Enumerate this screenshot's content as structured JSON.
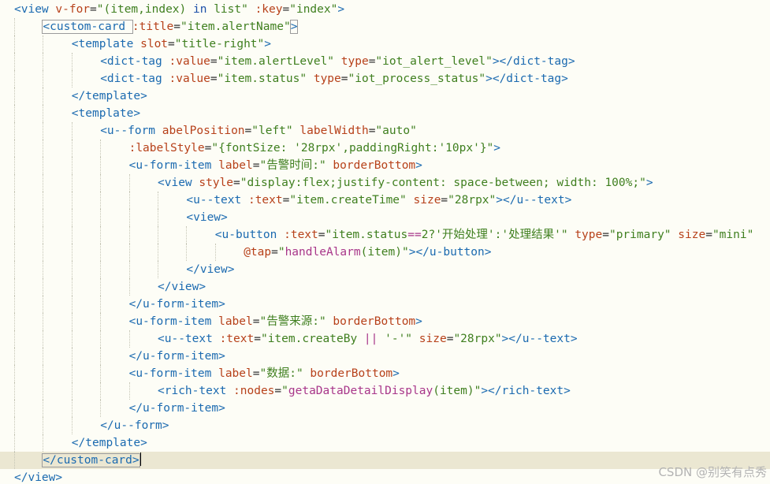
{
  "editor": {
    "watermark": "CSDN @别笑有点秀",
    "lines": [
      {
        "indent": 0,
        "tokens": [
          {
            "t": "<view ",
            "c": "tag"
          },
          {
            "t": "v-for",
            "c": "attr"
          },
          {
            "t": "=",
            "c": "punc"
          },
          {
            "t": "\"(item,index) ",
            "c": "str"
          },
          {
            "t": "in",
            "c": "kw"
          },
          {
            "t": " list\" ",
            "c": "str"
          },
          {
            "t": ":key",
            "c": "attr"
          },
          {
            "t": "=",
            "c": "punc"
          },
          {
            "t": "\"index\"",
            "c": "str"
          },
          {
            "t": ">",
            "c": "tag"
          }
        ]
      },
      {
        "indent": 1,
        "tokens": [
          {
            "t": "<custom-card ",
            "c": "tag",
            "box": true
          },
          {
            "t": ":title",
            "c": "attr"
          },
          {
            "t": "=",
            "c": "punc"
          },
          {
            "t": "\"item.alertName\"",
            "c": "str"
          },
          {
            "t": ">",
            "c": "tag",
            "box": true
          }
        ]
      },
      {
        "indent": 2,
        "tokens": [
          {
            "t": "<template ",
            "c": "tag"
          },
          {
            "t": "slot",
            "c": "attr"
          },
          {
            "t": "=",
            "c": "punc"
          },
          {
            "t": "\"title-right\"",
            "c": "str"
          },
          {
            "t": ">",
            "c": "tag"
          }
        ]
      },
      {
        "indent": 3,
        "tokens": [
          {
            "t": "<dict-tag ",
            "c": "tag"
          },
          {
            "t": ":value",
            "c": "attr"
          },
          {
            "t": "=",
            "c": "punc"
          },
          {
            "t": "\"item.alertLevel\" ",
            "c": "str"
          },
          {
            "t": "type",
            "c": "attr"
          },
          {
            "t": "=",
            "c": "punc"
          },
          {
            "t": "\"iot_alert_level\"",
            "c": "str"
          },
          {
            "t": "></dict-tag>",
            "c": "tag"
          }
        ]
      },
      {
        "indent": 3,
        "tokens": [
          {
            "t": "<dict-tag ",
            "c": "tag"
          },
          {
            "t": ":value",
            "c": "attr"
          },
          {
            "t": "=",
            "c": "punc"
          },
          {
            "t": "\"item.status\" ",
            "c": "str"
          },
          {
            "t": "type",
            "c": "attr"
          },
          {
            "t": "=",
            "c": "punc"
          },
          {
            "t": "\"iot_process_status\"",
            "c": "str"
          },
          {
            "t": "></dict-tag>",
            "c": "tag"
          }
        ]
      },
      {
        "indent": 2,
        "tokens": [
          {
            "t": "</template>",
            "c": "tag"
          }
        ]
      },
      {
        "indent": 2,
        "tokens": [
          {
            "t": "<template>",
            "c": "tag"
          }
        ]
      },
      {
        "indent": 3,
        "tokens": [
          {
            "t": "<u--form ",
            "c": "tag"
          },
          {
            "t": "abelPosition",
            "c": "attr"
          },
          {
            "t": "=",
            "c": "punc"
          },
          {
            "t": "\"left\" ",
            "c": "str"
          },
          {
            "t": "labelWidth",
            "c": "attr"
          },
          {
            "t": "=",
            "c": "punc"
          },
          {
            "t": "\"auto\"",
            "c": "str"
          }
        ]
      },
      {
        "indent": 4,
        "tokens": [
          {
            "t": ":labelStyle",
            "c": "attr"
          },
          {
            "t": "=",
            "c": "punc"
          },
          {
            "t": "\"{fontSize: '28rpx',paddingRight:'10px'}\"",
            "c": "str"
          },
          {
            "t": ">",
            "c": "tag"
          }
        ]
      },
      {
        "indent": 4,
        "tokens": [
          {
            "t": "<u-form-item ",
            "c": "tag"
          },
          {
            "t": "label",
            "c": "attr"
          },
          {
            "t": "=",
            "c": "punc"
          },
          {
            "t": "\"告警时间:\" ",
            "c": "str"
          },
          {
            "t": "borderBottom",
            "c": "attr"
          },
          {
            "t": ">",
            "c": "tag"
          }
        ]
      },
      {
        "indent": 5,
        "tokens": [
          {
            "t": "<view ",
            "c": "tag"
          },
          {
            "t": "style",
            "c": "attr"
          },
          {
            "t": "=",
            "c": "punc"
          },
          {
            "t": "\"display:flex;justify-content: space-between; width: 100%;\"",
            "c": "str"
          },
          {
            "t": ">",
            "c": "tag"
          }
        ]
      },
      {
        "indent": 6,
        "tokens": [
          {
            "t": "<u--text ",
            "c": "tag"
          },
          {
            "t": ":text",
            "c": "attr"
          },
          {
            "t": "=",
            "c": "punc"
          },
          {
            "t": "\"item.createTime\" ",
            "c": "str"
          },
          {
            "t": "size",
            "c": "attr"
          },
          {
            "t": "=",
            "c": "punc"
          },
          {
            "t": "\"28rpx\"",
            "c": "str"
          },
          {
            "t": "></u--text>",
            "c": "tag"
          }
        ]
      },
      {
        "indent": 6,
        "tokens": [
          {
            "t": "<view>",
            "c": "tag"
          }
        ]
      },
      {
        "indent": 7,
        "tokens": [
          {
            "t": "<u-button ",
            "c": "tag"
          },
          {
            "t": ":text",
            "c": "attr"
          },
          {
            "t": "=",
            "c": "punc"
          },
          {
            "t": "\"item.status",
            "c": "str"
          },
          {
            "t": "==",
            "c": "fn"
          },
          {
            "t": "2?'开始处理':'处理结果'\" ",
            "c": "str"
          },
          {
            "t": "type",
            "c": "attr"
          },
          {
            "t": "=",
            "c": "punc"
          },
          {
            "t": "\"primary\" ",
            "c": "str"
          },
          {
            "t": "size",
            "c": "attr"
          },
          {
            "t": "=",
            "c": "punc"
          },
          {
            "t": "\"mini\"",
            "c": "str"
          }
        ]
      },
      {
        "indent": 8,
        "tokens": [
          {
            "t": "@tap",
            "c": "attr"
          },
          {
            "t": "=",
            "c": "punc"
          },
          {
            "t": "\"",
            "c": "str"
          },
          {
            "t": "handleAlarm",
            "c": "fn"
          },
          {
            "t": "(item)\"",
            "c": "str"
          },
          {
            "t": "></u-button>",
            "c": "tag"
          }
        ]
      },
      {
        "indent": 6,
        "tokens": [
          {
            "t": "</view>",
            "c": "tag"
          }
        ]
      },
      {
        "indent": 5,
        "tokens": [
          {
            "t": "</view>",
            "c": "tag"
          }
        ]
      },
      {
        "indent": 4,
        "tokens": [
          {
            "t": "</u-form-item>",
            "c": "tag"
          }
        ]
      },
      {
        "indent": 4,
        "tokens": [
          {
            "t": "<u-form-item ",
            "c": "tag"
          },
          {
            "t": "label",
            "c": "attr"
          },
          {
            "t": "=",
            "c": "punc"
          },
          {
            "t": "\"告警来源:\" ",
            "c": "str"
          },
          {
            "t": "borderBottom",
            "c": "attr"
          },
          {
            "t": ">",
            "c": "tag"
          }
        ]
      },
      {
        "indent": 5,
        "tokens": [
          {
            "t": "<u--text ",
            "c": "tag"
          },
          {
            "t": ":text",
            "c": "attr"
          },
          {
            "t": "=",
            "c": "punc"
          },
          {
            "t": "\"item.createBy ",
            "c": "str"
          },
          {
            "t": "||",
            "c": "fn"
          },
          {
            "t": " '-'\" ",
            "c": "str"
          },
          {
            "t": "size",
            "c": "attr"
          },
          {
            "t": "=",
            "c": "punc"
          },
          {
            "t": "\"28rpx\"",
            "c": "str"
          },
          {
            "t": "></u--text>",
            "c": "tag"
          }
        ]
      },
      {
        "indent": 4,
        "tokens": [
          {
            "t": "</u-form-item>",
            "c": "tag"
          }
        ]
      },
      {
        "indent": 4,
        "tokens": [
          {
            "t": "<u-form-item ",
            "c": "tag"
          },
          {
            "t": "label",
            "c": "attr"
          },
          {
            "t": "=",
            "c": "punc"
          },
          {
            "t": "\"数据:\" ",
            "c": "str"
          },
          {
            "t": "borderBottom",
            "c": "attr"
          },
          {
            "t": ">",
            "c": "tag"
          }
        ]
      },
      {
        "indent": 5,
        "tokens": [
          {
            "t": "<rich-text ",
            "c": "tag"
          },
          {
            "t": ":nodes",
            "c": "attr"
          },
          {
            "t": "=",
            "c": "punc"
          },
          {
            "t": "\"",
            "c": "str"
          },
          {
            "t": "getaDataDetailDisplay",
            "c": "fn"
          },
          {
            "t": "(item)\"",
            "c": "str"
          },
          {
            "t": "></rich-text>",
            "c": "tag"
          }
        ]
      },
      {
        "indent": 4,
        "tokens": [
          {
            "t": "</u-form-item>",
            "c": "tag"
          }
        ]
      },
      {
        "indent": 3,
        "tokens": [
          {
            "t": "</u--form>",
            "c": "tag"
          }
        ]
      },
      {
        "indent": 2,
        "tokens": [
          {
            "t": "</template>",
            "c": "tag"
          }
        ]
      },
      {
        "indent": 1,
        "current": true,
        "caret": true,
        "tokens": [
          {
            "t": "</custom-card>",
            "c": "tag",
            "box": true
          }
        ]
      },
      {
        "indent": 0,
        "tokens": [
          {
            "t": "</view>",
            "c": "tag"
          }
        ]
      }
    ]
  }
}
